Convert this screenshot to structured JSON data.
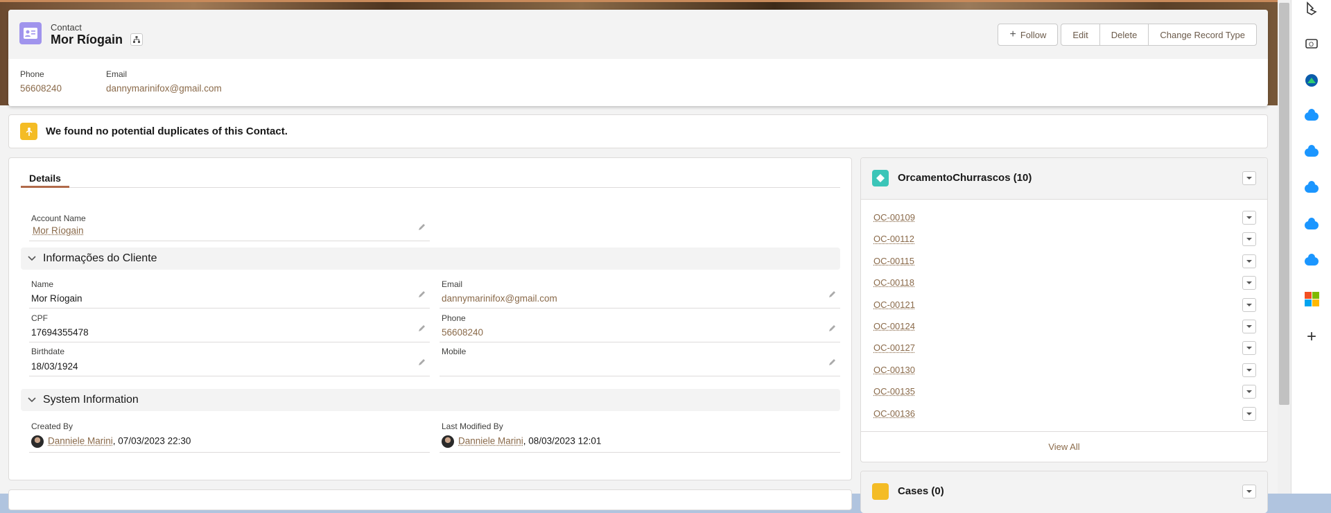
{
  "header": {
    "object_label": "Contact",
    "record_name": "Mor Ríogain",
    "buttons": {
      "follow": "Follow",
      "edit": "Edit",
      "delete": "Delete",
      "change_record_type": "Change Record Type"
    },
    "highlights": {
      "phone_label": "Phone",
      "phone_value": "56608240",
      "email_label": "Email",
      "email_value": "dannymarinifox@gmail.com"
    }
  },
  "duplicates": {
    "message": "We found no potential duplicates of this Contact."
  },
  "details": {
    "tab_label": "Details",
    "account_name_label": "Account Name",
    "account_name_value": "Mor Ríogain",
    "section_cliente": "Informações do Cliente",
    "fields": {
      "name_label": "Name",
      "name_value": "Mor Ríogain",
      "email_label": "Email",
      "email_value": "dannymarinifox@gmail.com",
      "cpf_label": "CPF",
      "cpf_value": "17694355478",
      "phone_label": "Phone",
      "phone_value": "56608240",
      "birthdate_label": "Birthdate",
      "birthdate_value": "18/03/1924",
      "mobile_label": "Mobile",
      "mobile_value": ""
    },
    "section_system": "System Information",
    "system": {
      "created_by_label": "Created By",
      "created_by_user": "Danniele Marini",
      "created_by_date": ", 07/03/2023 22:30",
      "modified_by_label": "Last Modified By",
      "modified_by_user": "Danniele Marini",
      "modified_by_date": ", 08/03/2023 12:01"
    }
  },
  "related": {
    "title": "OrcamentoChurrascos (10)",
    "items": [
      "OC-00109",
      "OC-00112",
      "OC-00115",
      "OC-00118",
      "OC-00121",
      "OC-00124",
      "OC-00127",
      "OC-00130",
      "OC-00135",
      "OC-00136"
    ],
    "view_all": "View All",
    "cases_title": "Cases (0)"
  },
  "colors": {
    "accent": "#b06a4a",
    "link": "#8a6a4a",
    "contact_icon": "#a094ed",
    "related_icon": "#3bc5b8",
    "warning_icon": "#f4bc25",
    "cloud_icon": "#1b96ff"
  },
  "sidebar_icons": [
    "bing-icon",
    "outlook-icon",
    "drive-icon",
    "salesforce-cloud-icon",
    "salesforce-cloud-icon",
    "salesforce-cloud-icon",
    "salesforce-cloud-icon",
    "salesforce-cloud-icon",
    "microsoft-icon",
    "plus-icon"
  ]
}
